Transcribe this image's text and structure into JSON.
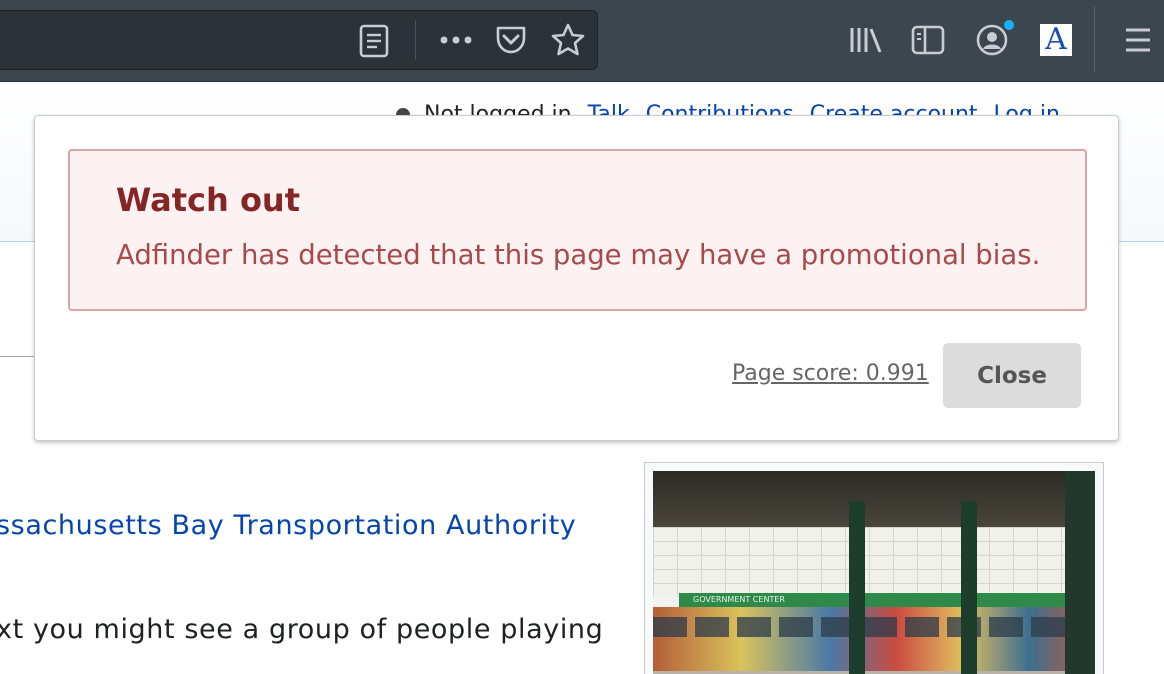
{
  "browser": {
    "toolbar_icons": [
      "reader-view-icon",
      "more-actions-icon",
      "pocket-icon",
      "bookmark-star-icon",
      "library-icon",
      "sidebar-icon",
      "account-icon",
      "extension-icon",
      "menu-icon"
    ],
    "extension_letter": "A"
  },
  "page": {
    "personal_tools": {
      "not_logged_in": "Not logged in",
      "talk": "Talk",
      "contributions": "Contributions",
      "create_account": "Create account",
      "log_in": "Log in"
    },
    "link_text": "ssachusetts Bay Transportation Authority",
    "body_text": "xt you might see a group of people playing",
    "photo_sign": "GOVERNMENT CENTER"
  },
  "popup": {
    "alert_title": "Watch out",
    "alert_message": "Adfinder has detected that this page may have a promotional bias.",
    "page_score_label": "Page score: 0.991",
    "close_label": "Close"
  },
  "colors": {
    "toolbar_bg": "#3c464f",
    "alert_bg": "#fdf2f2",
    "alert_border": "#dba4a4",
    "alert_title": "#862525",
    "alert_text": "#a94a4a",
    "link": "#0645ad"
  }
}
